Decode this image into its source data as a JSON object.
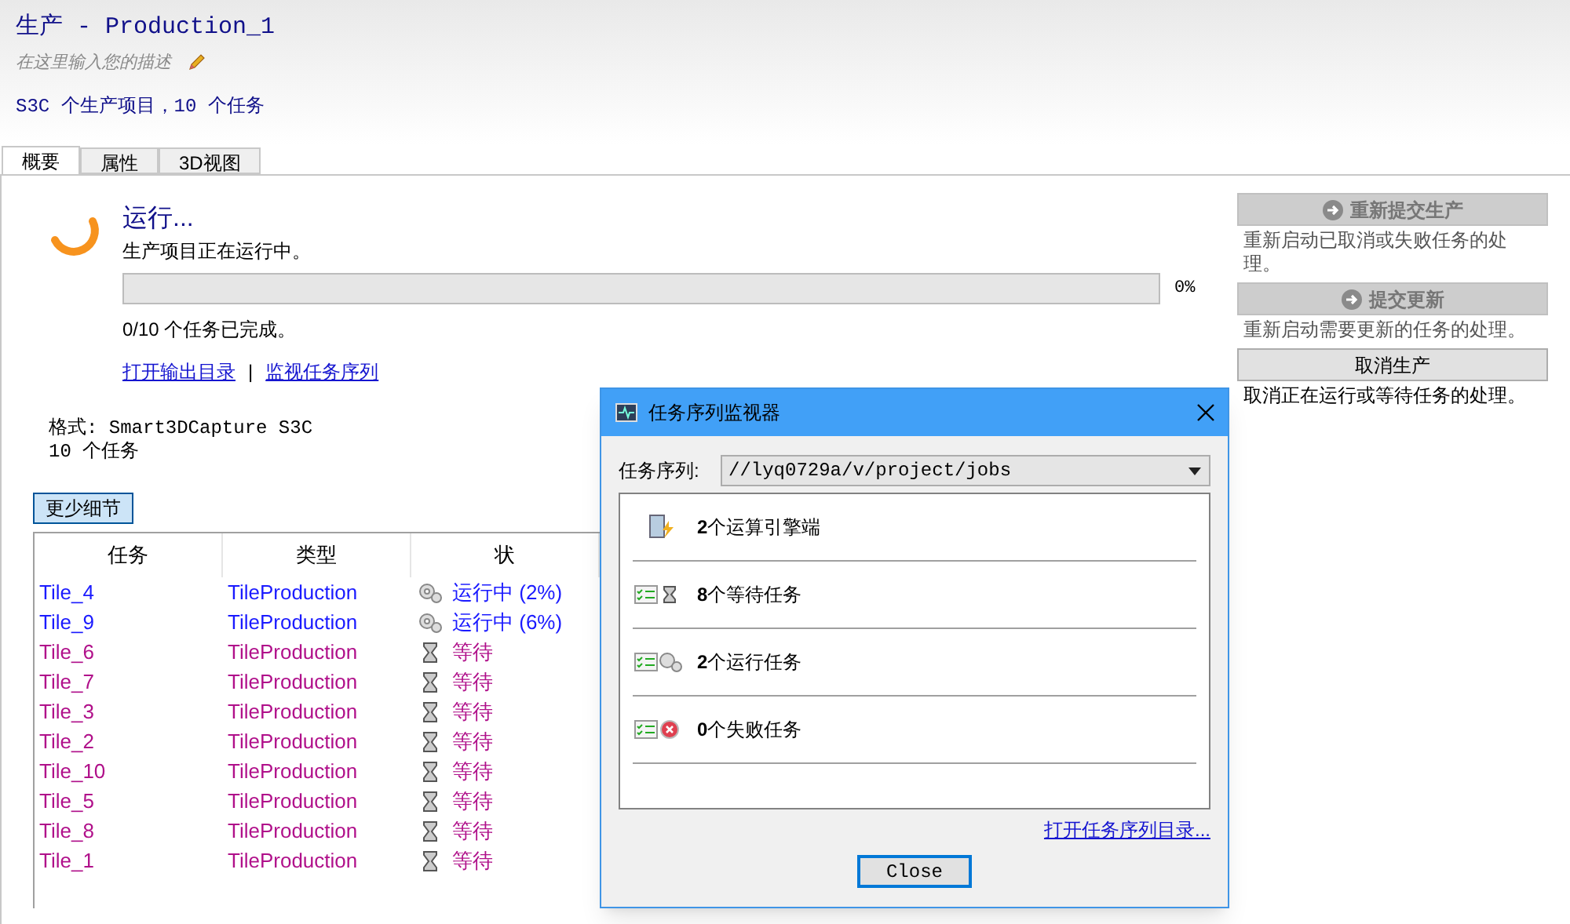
{
  "header": {
    "title": "生产 - Production_1",
    "description_placeholder": "在这里输入您的描述",
    "summary": "S3C 个生产项目，10 个任务"
  },
  "tabs": [
    {
      "label": "概要",
      "selected": true
    },
    {
      "label": "属性",
      "selected": false
    },
    {
      "label": "3D视图",
      "selected": false
    }
  ],
  "status": {
    "heading": "运行...",
    "message": "生产项目正在运行中。",
    "progress": {
      "level": 0,
      "reading": "0%"
    },
    "completed": "0/10 个任务已完成。",
    "links": [
      "打开输出目录",
      "监视任务序列"
    ],
    "separator": "|"
  },
  "actions": [
    {
      "label": "重新提交生产",
      "disabled": true,
      "description": "重新启动已取消或失败任务的处理。"
    },
    {
      "label": "提交更新",
      "disabled": true,
      "description": "重新启动需要更新的任务的处理。"
    },
    {
      "label": "取消生产",
      "disabled": false,
      "description": "取消正在运行或等待任务的处理。"
    }
  ],
  "format": {
    "format_line": "格式: Smart3DCapture S3C",
    "task_count": "10 个任务"
  },
  "details_button": "更少细节",
  "table": {
    "columns": [
      "任务",
      "类型",
      "状"
    ],
    "rows": [
      {
        "kind": "running",
        "task": "Tile_4",
        "type": "TileProduction",
        "status": "运行中 (2%)"
      },
      {
        "kind": "running",
        "task": "Tile_9",
        "type": "TileProduction",
        "status": "运行中 (6%)"
      },
      {
        "kind": "waiting",
        "task": "Tile_6",
        "type": "TileProduction",
        "status": "等待"
      },
      {
        "kind": "waiting",
        "task": "Tile_7",
        "type": "TileProduction",
        "status": "等待"
      },
      {
        "kind": "waiting",
        "task": "Tile_3",
        "type": "TileProduction",
        "status": "等待"
      },
      {
        "kind": "waiting",
        "task": "Tile_2",
        "type": "TileProduction",
        "status": "等待"
      },
      {
        "kind": "waiting",
        "task": "Tile_10",
        "type": "TileProduction",
        "status": "等待"
      },
      {
        "kind": "waiting",
        "task": "Tile_5",
        "type": "TileProduction",
        "status": "等待"
      },
      {
        "kind": "waiting",
        "task": "Tile_8",
        "type": "TileProduction",
        "status": "等待"
      },
      {
        "kind": "waiting",
        "task": "Tile_1",
        "type": "TileProduction",
        "status": "等待"
      }
    ]
  },
  "dialog": {
    "title": "任务序列监视器",
    "queue_label": "任务序列:",
    "queue_value": "//lyq0729a/v/project/jobs",
    "items": [
      {
        "kind": "engines",
        "count": "2",
        "label": "个运算引擎端"
      },
      {
        "kind": "waiting",
        "count": "8",
        "label": "个等待任务"
      },
      {
        "kind": "running",
        "count": "2",
        "label": "个运行任务"
      },
      {
        "kind": "failed",
        "count": "0",
        "label": "个失败任务"
      }
    ],
    "link": "打开任务序列目录...",
    "close_button": "Close"
  }
}
